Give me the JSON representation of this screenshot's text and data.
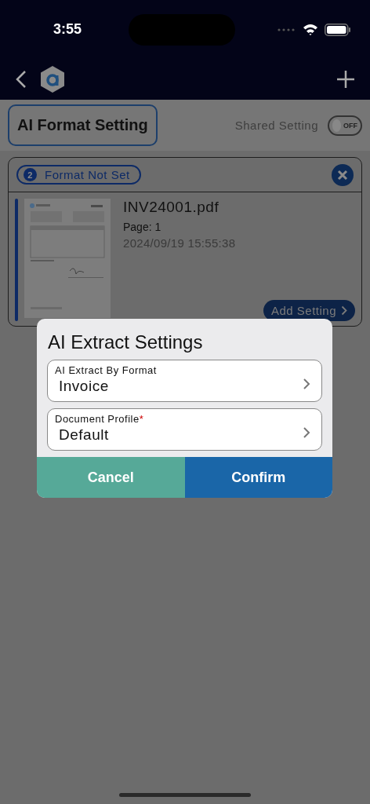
{
  "status_bar": {
    "time": "3:55"
  },
  "header": {
    "title": "AI Format Setting",
    "shared_label": "Shared Setting",
    "shared_toggle": {
      "on": false,
      "label": "OFF"
    }
  },
  "card": {
    "badge_count": "2",
    "badge_label": "Format Not Set",
    "file_name": "INV24001.pdf",
    "page": "Page: 1",
    "date": "2024/09/19 15:55:38",
    "action": "Add Setting"
  },
  "dialog": {
    "title": "AI Extract Settings",
    "fields": [
      {
        "label": "AI Extract By Format",
        "value": "Invoice"
      },
      {
        "label": "Document Profile",
        "required_mark": "*",
        "value": "Default"
      }
    ],
    "buttons": [
      {
        "label": "Cancel",
        "kind": "cancel"
      },
      {
        "label": "Confirm",
        "kind": "confirm"
      }
    ]
  }
}
